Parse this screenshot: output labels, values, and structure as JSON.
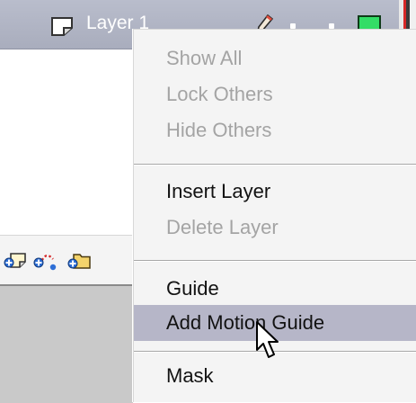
{
  "layer": {
    "name": "Layer 1",
    "outline_color": "#33dd66"
  },
  "toolbar": {
    "icons": [
      "insert-layer-icon",
      "add-motion-guide-icon",
      "insert-layer-folder-icon"
    ]
  },
  "context_menu": {
    "items": [
      {
        "label": "Show All",
        "enabled": false
      },
      {
        "label": "Lock Others",
        "enabled": false
      },
      {
        "label": "Hide Others",
        "enabled": false
      },
      {
        "label": "Insert Layer",
        "enabled": true
      },
      {
        "label": "Delete Layer",
        "enabled": false
      },
      {
        "label": "Guide",
        "enabled": true
      },
      {
        "label": "Add Motion Guide",
        "enabled": true,
        "highlighted": true
      },
      {
        "label": "Mask",
        "enabled": true
      }
    ]
  },
  "colors": {
    "highlight": "#b6b6c8",
    "disabled_text": "#a4a4a4",
    "layer_row": "#b0b4c4"
  }
}
